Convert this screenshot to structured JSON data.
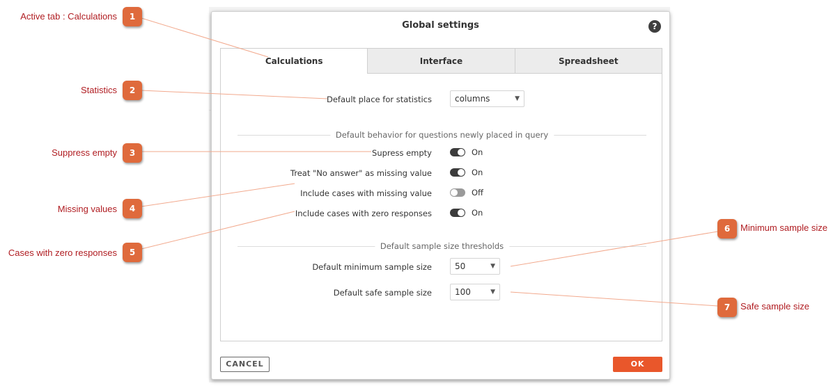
{
  "dialog": {
    "title": "Global settings",
    "help": "?",
    "tabs": [
      "Calculations",
      "Interface",
      "Spreadsheet"
    ],
    "statistics": {
      "label": "Default place for statistics",
      "value": "columns"
    },
    "behavior_section": "Default behavior for questions newly placed in query",
    "toggles": [
      {
        "label": "Supress empty",
        "state": "On"
      },
      {
        "label": "Treat \"No answer\" as missing value",
        "state": "On"
      },
      {
        "label": "Include cases with missing value",
        "state": "Off"
      },
      {
        "label": "Include cases with zero responses",
        "state": "On"
      }
    ],
    "sample_section": "Default sample size thresholds",
    "min_sample": {
      "label": "Default minimum sample size",
      "value": "50"
    },
    "safe_sample": {
      "label": "Default safe sample size",
      "value": "100"
    },
    "cancel": "CANCEL",
    "ok": "OK"
  },
  "annotations": [
    {
      "number": "1",
      "label": "Active tab : Calculations"
    },
    {
      "number": "2",
      "label": "Statistics"
    },
    {
      "number": "3",
      "label": "Suppress empty"
    },
    {
      "number": "4",
      "label": "Missing values"
    },
    {
      "number": "5",
      "label": "Cases with zero responses"
    },
    {
      "number": "6",
      "label": "Minimum sample size"
    },
    {
      "number": "7",
      "label": "Safe sample size"
    }
  ],
  "colors": {
    "accent": "#e9572b",
    "badge": "#df6a3c",
    "annotation_text": "#b01d22",
    "toggle_on": "#3c3c3c",
    "toggle_off": "#9a9a9a"
  }
}
